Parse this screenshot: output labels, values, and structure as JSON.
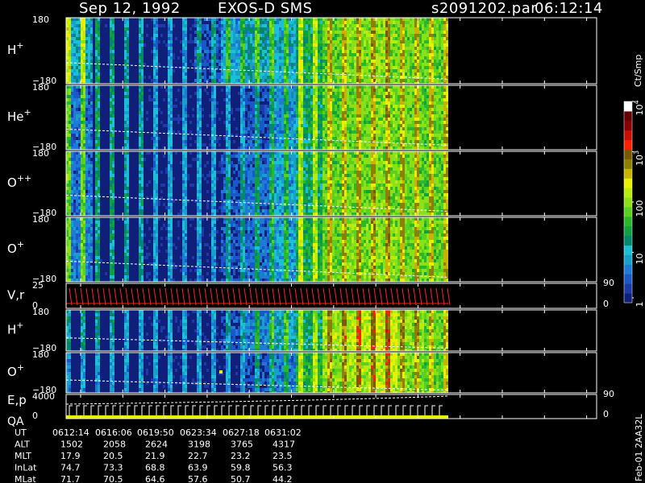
{
  "header": {
    "date": "Sep 12, 1992",
    "mission": "EXOS-D SMS",
    "file": "s2091202.par",
    "time": "06:12:14"
  },
  "colorbar": {
    "unit": "Ct/Smp",
    "ticks": [
      "1",
      "10",
      "100",
      "10^3",
      "10^4"
    ],
    "colors": [
      "#0f1f7a",
      "#1e3aa6",
      "#1858c8",
      "#1e7ad6",
      "#19a0c8",
      "#19c0d6",
      "#00886e",
      "#10a040",
      "#2ab82a",
      "#5ad020",
      "#8ce018",
      "#b8ec10",
      "#e8f000",
      "#c8b400",
      "#8c8000",
      "#7a5a00",
      "#ff2000",
      "#c81000",
      "#8c0000",
      "#640000",
      "#ffffff"
    ]
  },
  "side_text": "Feb-01 2AA32L",
  "panels": [
    {
      "id": "h-plus",
      "label": "H",
      "sup": "+",
      "top": "180",
      "bottom": "−180"
    },
    {
      "id": "he-plus",
      "label": "He",
      "sup": "+",
      "top": "180",
      "bottom": "−180"
    },
    {
      "id": "o-plus-plus",
      "label": "O",
      "sup": "++",
      "top": "180",
      "bottom": "−180"
    },
    {
      "id": "o-plus",
      "label": "O",
      "sup": "+",
      "top": "180",
      "bottom": "−180"
    },
    {
      "id": "vr",
      "label": "V,r",
      "sup": "",
      "top": "25",
      "bottom": "0",
      "right_top": "90",
      "right_bottom": "0"
    },
    {
      "id": "h-plus-2",
      "label": "H",
      "sup": "+",
      "top": "180",
      "bottom": "−180"
    },
    {
      "id": "o-plus-2",
      "label": "O",
      "sup": "+",
      "top": "180",
      "bottom": "−180"
    },
    {
      "id": "ep",
      "label": "E,p",
      "label2": "QA",
      "sup": "",
      "top": "4000",
      "bottom": "0",
      "right_top": "90",
      "right_bottom": "0"
    }
  ],
  "ephemeris": {
    "rows": [
      {
        "label": "UT",
        "values": [
          "0612:14",
          "0616:06",
          "0619:50",
          "0623:34",
          "0627:18",
          "0631:02"
        ]
      },
      {
        "label": "ALT",
        "values": [
          "1502",
          "2058",
          "2624",
          "3198",
          "3765",
          "4317"
        ]
      },
      {
        "label": "MLT",
        "values": [
          "17.9",
          "20.5",
          "21.9",
          "22.7",
          "23.2",
          "23.5"
        ]
      },
      {
        "label": "InLat",
        "values": [
          "74.7",
          "73.3",
          "68.8",
          "63.9",
          "59.8",
          "56.3"
        ]
      },
      {
        "label": "MLat",
        "values": [
          "71.7",
          "70.5",
          "64.6",
          "57.6",
          "50.7",
          "44.2"
        ]
      }
    ]
  },
  "chart_data": {
    "type": "heatmap",
    "title": "Sep 12, 1992   EXOS-D SMS",
    "xlabel": "",
    "x_ticks": [
      "0612:14",
      "0616:06",
      "0619:50",
      "0623:34",
      "0627:18",
      "0631:02"
    ],
    "colorbar_scale": "log",
    "colorbar_range": [
      1,
      10000
    ],
    "series": [
      {
        "name": "H+",
        "ylim": [
          -180,
          180
        ],
        "level_profile": [
          30,
          3,
          2,
          1,
          1,
          2,
          6,
          10,
          8,
          25,
          60,
          80,
          90,
          70,
          60
        ]
      },
      {
        "name": "He+",
        "ylim": [
          -180,
          180
        ],
        "level_profile": [
          10,
          3,
          2,
          1,
          1,
          1,
          1,
          2,
          5,
          20,
          60,
          70,
          80,
          70,
          60
        ]
      },
      {
        "name": "O++",
        "ylim": [
          -180,
          180
        ],
        "level_profile": [
          12,
          3,
          2,
          1,
          1,
          1,
          2,
          3,
          6,
          20,
          60,
          70,
          80,
          70,
          60
        ]
      },
      {
        "name": "O+",
        "ylim": [
          -180,
          180
        ],
        "level_profile": [
          12,
          3,
          2,
          1,
          1,
          1,
          2,
          3,
          6,
          25,
          70,
          80,
          90,
          70,
          60
        ]
      },
      {
        "name": "H+ (2)",
        "ylim": [
          -180,
          180
        ],
        "level_profile": [
          2,
          2,
          1,
          1,
          1,
          1,
          2,
          4,
          8,
          20,
          120,
          150,
          200,
          100,
          60
        ]
      },
      {
        "name": "O+ (2)",
        "ylim": [
          -180,
          180
        ],
        "level_profile": [
          1,
          1,
          1,
          1,
          1,
          1,
          1,
          2,
          4,
          30,
          90,
          120,
          160,
          80,
          50
        ]
      }
    ]
  }
}
